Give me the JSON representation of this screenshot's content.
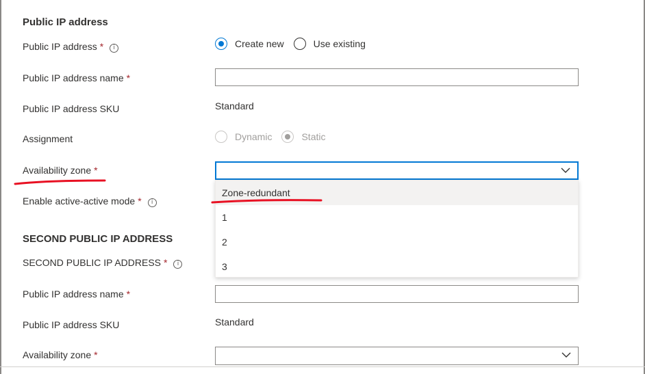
{
  "sections": {
    "public_ip": {
      "title": "Public IP address"
    },
    "second_public_ip": {
      "title": "SECOND PUBLIC IP ADDRESS"
    }
  },
  "required_marker": "*",
  "info_glyph": "i",
  "fields": {
    "public_ip_address": {
      "label": "Public IP address",
      "options": [
        "Create new",
        "Use existing"
      ],
      "selected": "Create new"
    },
    "public_ip_name": {
      "label": "Public IP address name",
      "value": ""
    },
    "public_ip_sku": {
      "label": "Public IP address SKU",
      "value": "Standard"
    },
    "assignment": {
      "label": "Assignment",
      "options": [
        "Dynamic",
        "Static"
      ],
      "selected": "Static",
      "disabled": true
    },
    "availability_zone": {
      "label": "Availability zone",
      "value": "",
      "open": true,
      "options": [
        "Zone-redundant",
        "1",
        "2",
        "3"
      ],
      "highlighted": "Zone-redundant"
    },
    "active_active": {
      "label": "Enable active-active mode"
    },
    "second_public_ip_address": {
      "label": "SECOND PUBLIC IP ADDRESS"
    },
    "second_public_ip_name": {
      "label": "Public IP address name",
      "value": ""
    },
    "second_public_ip_sku": {
      "label": "Public IP address SKU",
      "value": "Standard"
    },
    "second_availability_zone": {
      "label": "Availability zone",
      "value": ""
    }
  },
  "colors": {
    "accent": "#0078d4",
    "required": "#a4262c",
    "annotation": "#e81123"
  },
  "icons": {
    "info": "info-icon",
    "dropdown": "chevron-down-icon"
  }
}
